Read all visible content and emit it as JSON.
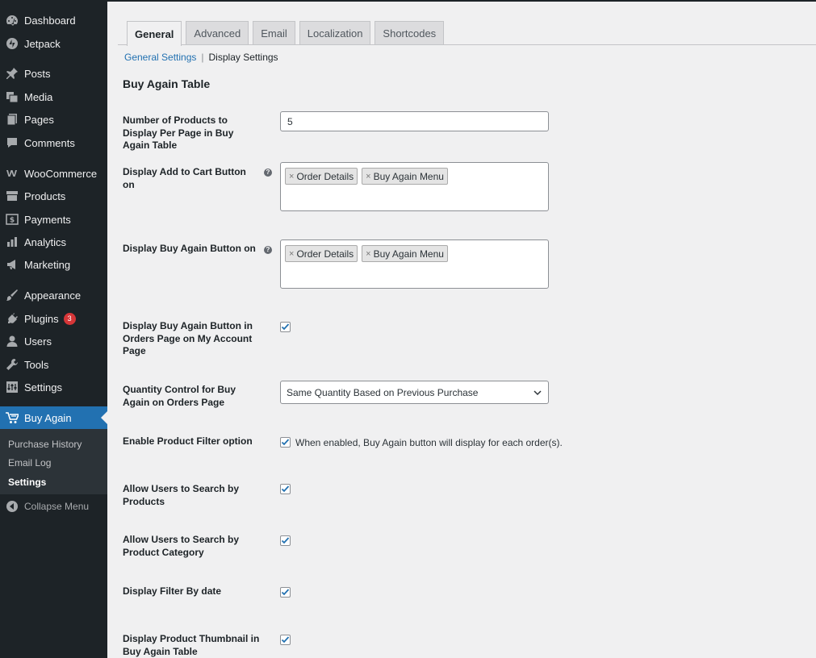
{
  "sidebar": {
    "items": [
      {
        "label": "Dashboard",
        "icon": "dashboard-icon"
      },
      {
        "label": "Jetpack",
        "icon": "jetpack-icon"
      },
      {
        "label": "Posts",
        "icon": "pin-icon"
      },
      {
        "label": "Media",
        "icon": "media-icon"
      },
      {
        "label": "Pages",
        "icon": "pages-icon"
      },
      {
        "label": "Comments",
        "icon": "comment-icon"
      },
      {
        "label": "WooCommerce",
        "icon": "woocommerce-icon"
      },
      {
        "label": "Products",
        "icon": "archive-icon"
      },
      {
        "label": "Payments",
        "icon": "payments-icon"
      },
      {
        "label": "Analytics",
        "icon": "bar-chart-icon"
      },
      {
        "label": "Marketing",
        "icon": "megaphone-icon"
      },
      {
        "label": "Appearance",
        "icon": "brush-icon"
      },
      {
        "label": "Plugins",
        "icon": "plug-icon",
        "badge": "3"
      },
      {
        "label": "Users",
        "icon": "user-icon"
      },
      {
        "label": "Tools",
        "icon": "wrench-icon"
      },
      {
        "label": "Settings",
        "icon": "settings-icon"
      },
      {
        "label": "Buy Again",
        "icon": "cart-icon"
      }
    ],
    "submenu": [
      "Purchase History",
      "Email Log",
      "Settings"
    ],
    "collapse_label": "Collapse Menu"
  },
  "tabs": [
    "General",
    "Advanced",
    "Email",
    "Localization",
    "Shortcodes"
  ],
  "subnav": {
    "link": "General Settings",
    "separator": "|",
    "current": "Display Settings"
  },
  "section_title": "Buy Again Table",
  "fields": {
    "products_per_page": {
      "label": "Number of Products to Display Per Page in Buy Again Table",
      "value": "5"
    },
    "add_to_cart_on": {
      "label": "Display Add to Cart Button on",
      "chips": [
        "Order Details",
        "Buy Again Menu"
      ]
    },
    "buy_again_on": {
      "label": "Display Buy Again Button on",
      "chips": [
        "Order Details",
        "Buy Again Menu"
      ]
    },
    "orders_page_button": {
      "label": "Display Buy Again Button in Orders Page on My Account Page",
      "checked": true
    },
    "quantity_control": {
      "label": "Quantity Control for Buy Again on Orders Page",
      "selected": "Same Quantity Based on Previous Purchase"
    },
    "product_filter": {
      "label": "Enable Product Filter option",
      "checked": true,
      "description": "When enabled, Buy Again button will display for each order(s)."
    },
    "search_products": {
      "label": "Allow Users to Search by Products",
      "checked": true
    },
    "search_category": {
      "label": "Allow Users to Search by Product Category",
      "checked": true
    },
    "filter_date": {
      "label": "Display Filter By date",
      "checked": true
    },
    "product_thumbnail": {
      "label": "Display Product Thumbnail in Buy Again Table",
      "checked": true
    }
  },
  "colors": {
    "sidebar_bg": "#1d2327",
    "accent": "#2271b1",
    "badge": "#d63638",
    "page_bg": "#f0f0f1"
  }
}
